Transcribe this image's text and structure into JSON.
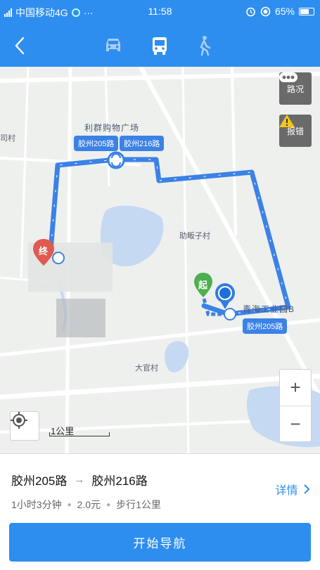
{
  "status_bar": {
    "network": "4G",
    "carrier": "中国移动4G",
    "more": "···",
    "time": "11:58",
    "battery": "65%"
  },
  "nav": {
    "back_icon": "chevron-left-icon",
    "modes": [
      {
        "icon": "car-icon",
        "selected": false
      },
      {
        "icon": "bus-icon",
        "selected": true
      },
      {
        "icon": "walk-icon",
        "selected": false
      }
    ]
  },
  "map": {
    "labels": {
      "mall": "利群购物广场",
      "village1": "助畈子村",
      "village2": "大官村",
      "industrial": "青海工业园B",
      "edge": "司村"
    },
    "route_tags": {
      "tag1": "胶州205路",
      "tag2": "胶州216路",
      "tag3": "胶州205路"
    },
    "markers": {
      "start": "起",
      "end": "终"
    },
    "road_condition_label": "路况",
    "report_error_label": "报错",
    "zoom_in": "+",
    "zoom_out": "−",
    "scale_label": "1公里"
  },
  "route": {
    "line1": "胶州205路",
    "arrow": "→",
    "line2": "胶州216路",
    "details_label": "详情",
    "duration": "1小时3分钟",
    "fare": "2.0元",
    "walk": "步行1公里"
  },
  "start_button": "开始导航",
  "colors": {
    "primary": "#2e8ef0",
    "route": "#3b82e6",
    "start_marker": "#4caf50",
    "end_marker": "#e05a50"
  }
}
